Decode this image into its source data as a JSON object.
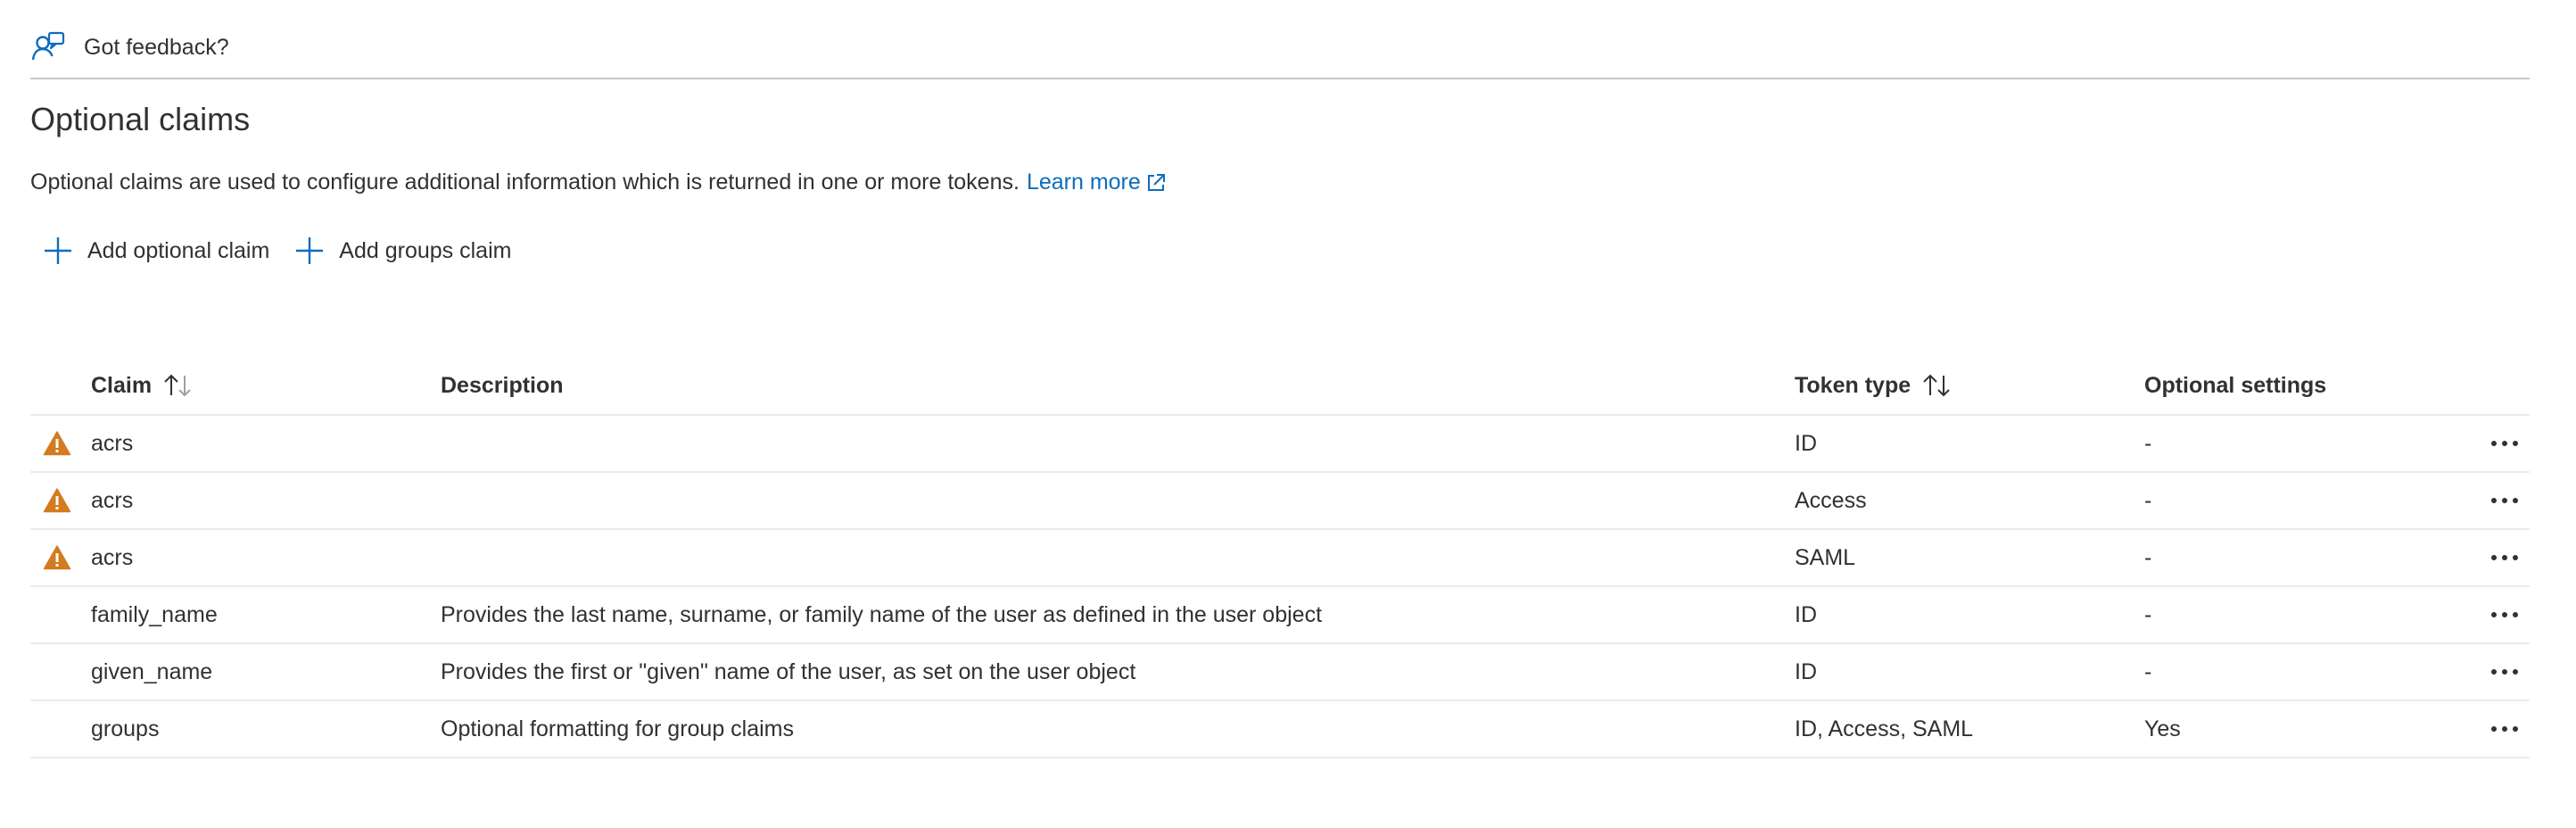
{
  "feedback": {
    "label": "Got feedback?",
    "icon": "feedback-person-icon"
  },
  "page": {
    "title": "Optional claims",
    "description": "Optional claims are used to configure additional information which is returned in one or more tokens.",
    "learn_more": "Learn more"
  },
  "toolbar": {
    "add_optional_claim": "Add optional claim",
    "add_groups_claim": "Add groups claim"
  },
  "table": {
    "headers": {
      "claim": "Claim",
      "description": "Description",
      "token_type": "Token type",
      "optional_settings": "Optional settings"
    },
    "rows": [
      {
        "warning": true,
        "claim": "acrs",
        "description": "",
        "token_type": "ID",
        "optional_settings": "-"
      },
      {
        "warning": true,
        "claim": "acrs",
        "description": "",
        "token_type": "Access",
        "optional_settings": "-"
      },
      {
        "warning": true,
        "claim": "acrs",
        "description": "",
        "token_type": "SAML",
        "optional_settings": "-"
      },
      {
        "warning": false,
        "claim": "family_name",
        "description": "Provides the last name, surname, or family name of the user as defined in the user object",
        "token_type": "ID",
        "optional_settings": "-"
      },
      {
        "warning": false,
        "claim": "given_name",
        "description": "Provides the first or \"given\" name of the user, as set on the user object",
        "token_type": "ID",
        "optional_settings": "-"
      },
      {
        "warning": false,
        "claim": "groups",
        "description": "Optional formatting for group claims",
        "token_type": "ID, Access, SAML",
        "optional_settings": "Yes"
      }
    ]
  },
  "colors": {
    "accent": "#0f6cbd",
    "warning": "#d47a1f",
    "text": "#323130",
    "divider": "#edebe9"
  }
}
